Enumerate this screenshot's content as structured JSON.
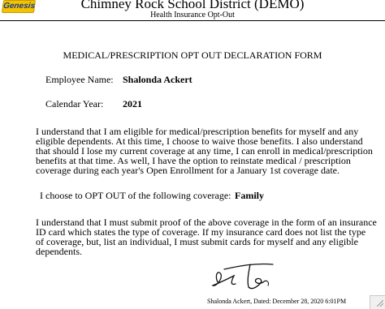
{
  "header": {
    "logo_text": "Genesis",
    "school_name": "Chimney Rock School District (DEMO)",
    "subtitle": "Health Insurance Opt-Out"
  },
  "form": {
    "title": "MEDICAL/PRESCRIPTION OPT OUT DECLARATION FORM",
    "employee_label": "Employee Name:",
    "employee_name": "Shalonda Ackert",
    "year_label": "Calendar Year:",
    "year": "2021",
    "para1_line1": "I understand that I am eligible for medical/prescription benefits for myself and any",
    "para1_line2": "eligible dependents.  At this time, I choose to waive those benefits.  I also understand",
    "para1_line3": "that should I lose my current coverage at any time, I can enroll in medical/prescription",
    "para1_line4": "benefits at that time.  As well, I have the option to reinstate medical / prescription",
    "para1_line5": "coverage during each year's Open Enrollment for a January 1st coverage date.",
    "optout_label": "I choose to OPT OUT of the following coverage:",
    "optout_value": "Family",
    "para2_line1": "I understand that I must submit proof of the above coverage in the form of an insurance",
    "para2_line2": "ID card which states the type of coverage.  If my insurance card does not list the type",
    "para2_line3": "of coverage, but, list an individual, I must submit cards for myself and any eligible",
    "para2_line4": "dependents.",
    "signature_caption": "Shalonda Ackert, Dated: December 28, 2020 6:01PM"
  },
  "colors": {
    "logo_bg": "#f3c300",
    "logo_text": "#1a3a8a"
  }
}
